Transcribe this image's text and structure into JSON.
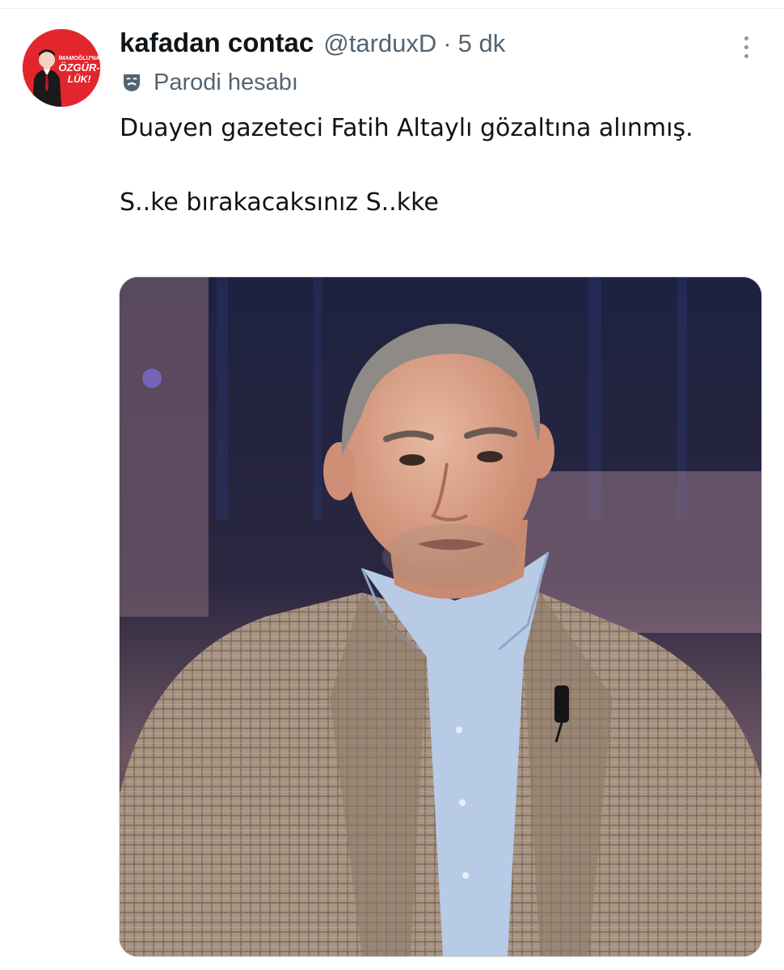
{
  "tweet": {
    "display_name": "kafadan contac",
    "handle": "@tarduxD",
    "separator": "·",
    "time": "5 dk",
    "parody_label": "Parodi hesabı",
    "text_line1": "Duayen gazeteci Fatih Altaylı gözaltına alınmış.",
    "text_line2": "S..ke bırakacaksınız S..kke"
  },
  "avatar": {
    "text_top": "İMAMOĞLU'NA",
    "text_mid": "ÖZGÜR-",
    "text_bot": "LÜK!",
    "background_color": "#e3262d"
  },
  "icons": {
    "more": "more-dots-icon",
    "parody": "theater-mask-icon"
  },
  "media": {
    "type": "photo"
  }
}
